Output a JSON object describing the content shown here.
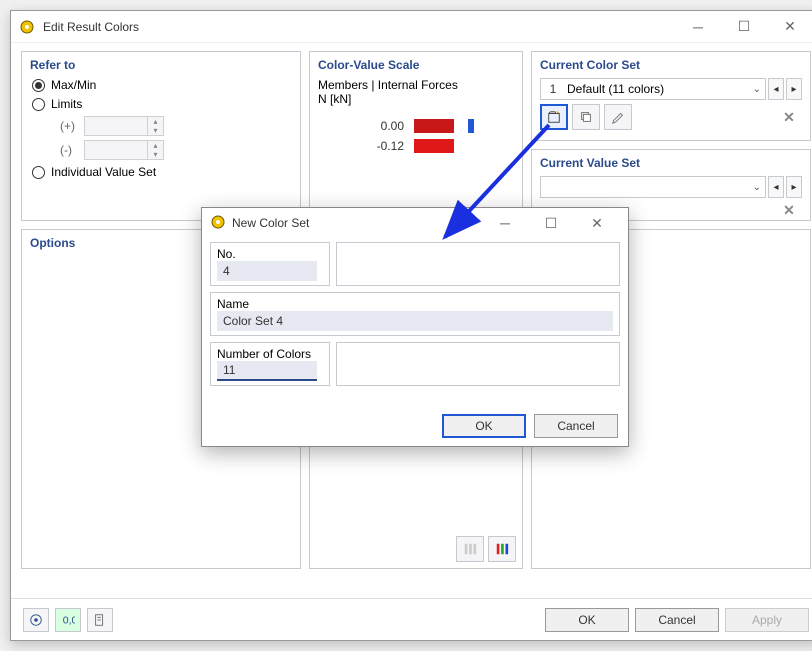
{
  "window": {
    "title": "Edit Result Colors"
  },
  "panels": {
    "refer_to": {
      "legend": "Refer to",
      "max_min": "Max/Min",
      "limits": "Limits",
      "plus": "(+)",
      "minus": "(-)",
      "individual": "Individual Value Set"
    },
    "options": {
      "legend": "Options"
    },
    "color_value_scale": {
      "legend": "Color-Value Scale",
      "line1": "Members | Internal Forces",
      "line2": "N [kN]",
      "values": [
        "0.00",
        "-0.12"
      ]
    },
    "current_color_set": {
      "legend": "Current Color Set",
      "index": "1",
      "selected": "Default (11 colors)"
    },
    "current_value_set": {
      "legend": "Current Value Set"
    }
  },
  "dialog": {
    "title": "New Color Set",
    "no_label": "No.",
    "no_value": "4",
    "name_label": "Name",
    "name_value": "Color Set 4",
    "num_label": "Number of Colors",
    "num_value": "11",
    "ok": "OK",
    "cancel": "Cancel"
  },
  "footer": {
    "ok": "OK",
    "cancel": "Cancel",
    "apply": "Apply"
  }
}
